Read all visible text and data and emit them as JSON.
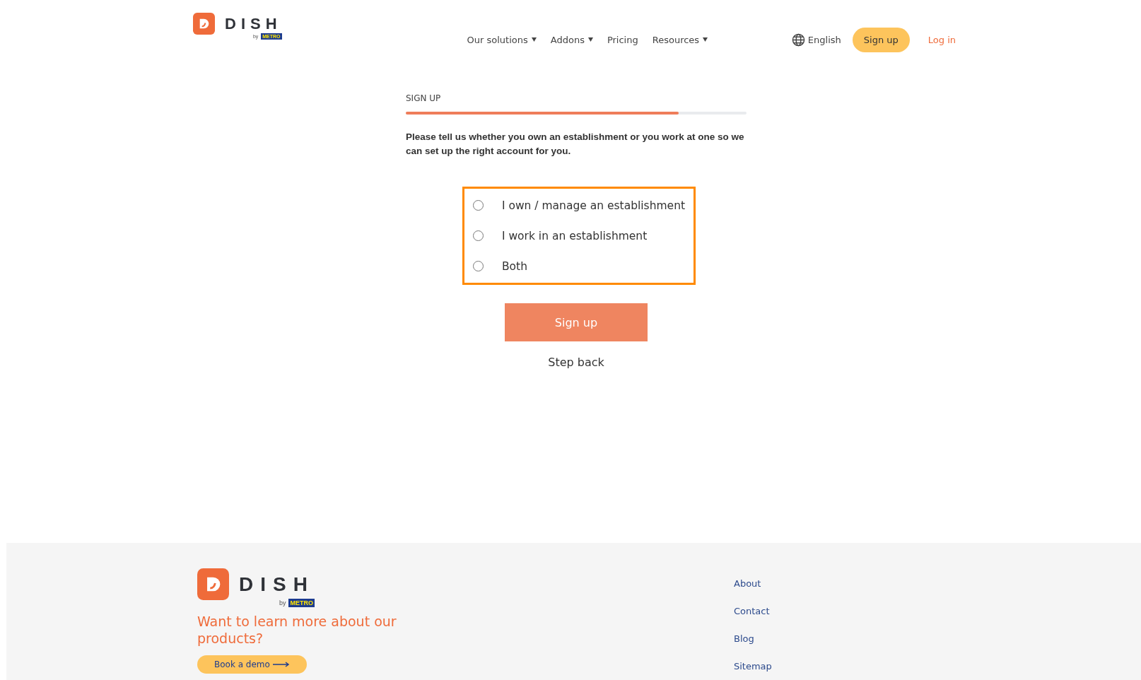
{
  "header": {
    "logo": {
      "wordmark": "DISH",
      "by": "by",
      "partner": "METRO"
    },
    "nav": [
      {
        "label": "Our solutions",
        "dropdown": true
      },
      {
        "label": "Addons",
        "dropdown": true
      },
      {
        "label": "Pricing",
        "dropdown": false
      },
      {
        "label": "Resources",
        "dropdown": true
      }
    ],
    "language": "English",
    "signup_button": "Sign up",
    "login_link": "Log in"
  },
  "form": {
    "step_title": "SIGN UP",
    "progress": {
      "level": 0.8
    },
    "prompt": "Please tell us whether you own an establishment or you work at one so we can set up the right account for you.",
    "options_highlighted": true,
    "options": [
      {
        "label": "I own / manage an establishment",
        "selected": false
      },
      {
        "label": "I work in an establishment",
        "selected": false
      },
      {
        "label": "Both",
        "selected": false
      }
    ],
    "submit_button": "Sign up",
    "back_link": "Step back"
  },
  "footer": {
    "logo": {
      "wordmark": "DISH",
      "by": "by",
      "partner": "METRO"
    },
    "heading": "Want to learn more about our products?",
    "demo_button": "Book a demo",
    "links": [
      "About",
      "Contact",
      "Blog",
      "Sitemap"
    ]
  }
}
